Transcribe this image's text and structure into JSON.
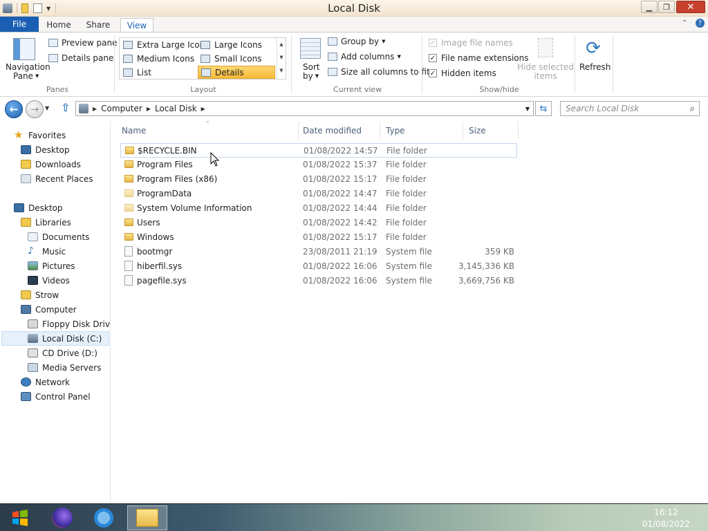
{
  "window": {
    "title": "Local Disk"
  },
  "tabs": {
    "file": "File",
    "home": "Home",
    "share": "Share",
    "view": "View"
  },
  "ribbon": {
    "panes": {
      "navigation_pane": "Navigation",
      "navigation_pane2": "Pane",
      "preview_pane": "Preview pane",
      "details_pane": "Details pane",
      "group_label": "Panes"
    },
    "layout": {
      "items": [
        "Extra Large Icons",
        "Large Icons",
        "Medium Icons",
        "Small Icons",
        "List",
        "Details"
      ],
      "group_label": "Layout"
    },
    "current_view": {
      "sort_by": "Sort",
      "sort_by2": "by",
      "group_by": "Group by",
      "add_columns": "Add columns",
      "size_all": "Size all columns to fit",
      "group_label": "Current view"
    },
    "show_hide": {
      "image_file_names": "Image file names",
      "file_name_extensions": "File name extensions",
      "hidden_items": "Hidden items",
      "hide_selected": "Hide selected",
      "hide_selected2": "items",
      "group_label": "Show/hide"
    },
    "refresh": "Refresh"
  },
  "address": {
    "crumbs": [
      "Computer",
      "Local Disk"
    ],
    "search_placeholder": "Search Local Disk"
  },
  "navpane": {
    "items": [
      "Favorites",
      "Desktop",
      "Downloads",
      "Recent Places",
      "Desktop",
      "Libraries",
      "Documents",
      "Music",
      "Pictures",
      "Videos",
      "Strow",
      "Computer",
      "Floppy Disk Drive (",
      "Local Disk (C:)",
      "CD Drive (D:)",
      "Media Servers",
      "Network",
      "Control Panel"
    ]
  },
  "columns": {
    "name": "Name",
    "date": "Date modified",
    "type": "Type",
    "size": "Size"
  },
  "files": [
    {
      "name": "$RECYCLE.BIN",
      "date": "01/08/2022 14:57",
      "type": "File folder",
      "size": ""
    },
    {
      "name": "Program Files",
      "date": "01/08/2022 15:37",
      "type": "File folder",
      "size": ""
    },
    {
      "name": "Program Files (x86)",
      "date": "01/08/2022 15:17",
      "type": "File folder",
      "size": ""
    },
    {
      "name": "ProgramData",
      "date": "01/08/2022 14:47",
      "type": "File folder",
      "size": ""
    },
    {
      "name": "System Volume Information",
      "date": "01/08/2022 14:44",
      "type": "File folder",
      "size": ""
    },
    {
      "name": "Users",
      "date": "01/08/2022 14:42",
      "type": "File folder",
      "size": ""
    },
    {
      "name": "Windows",
      "date": "01/08/2022 15:17",
      "type": "File folder",
      "size": ""
    },
    {
      "name": "bootmgr",
      "date": "23/08/2011 21:19",
      "type": "System file",
      "size": "359 KB"
    },
    {
      "name": "hiberfil.sys",
      "date": "01/08/2022 16:06",
      "type": "System file",
      "size": "3,145,336 KB"
    },
    {
      "name": "pagefile.sys",
      "date": "01/08/2022 16:06",
      "type": "System file",
      "size": "3,669,756 KB"
    }
  ],
  "taskbar": {
    "time": "16:12",
    "date": "01/08/2022"
  }
}
